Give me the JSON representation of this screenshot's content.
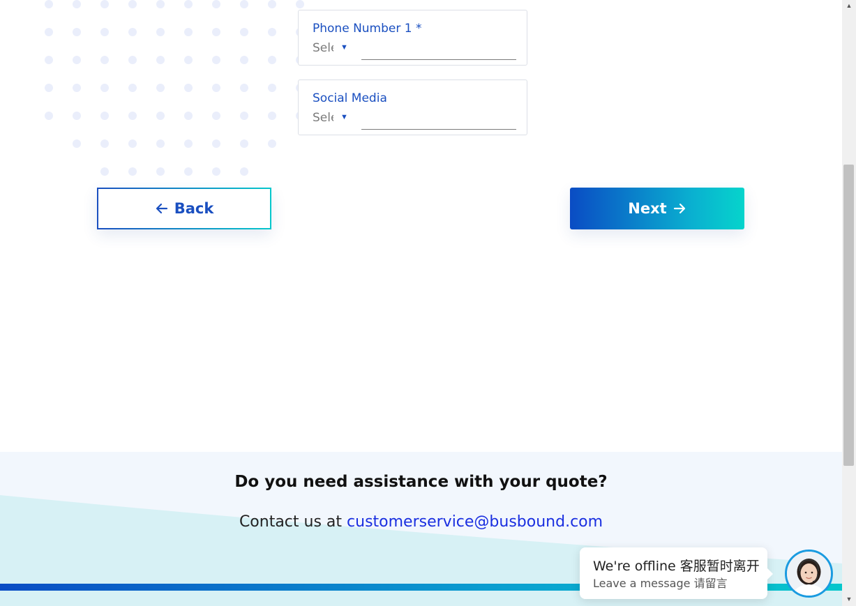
{
  "form": {
    "phone": {
      "label": "Phone Number 1 *",
      "select_text": "Select",
      "caret_icon": "caret-down-icon"
    },
    "social": {
      "label": "Social Media",
      "select_text": "Select",
      "caret_icon": "caret-down-icon"
    }
  },
  "navigation": {
    "back_label": "Back",
    "back_icon": "arrow-left-icon",
    "next_label": "Next",
    "next_icon": "arrow-right-icon"
  },
  "footer": {
    "title": "Do you need assistance with your quote?",
    "contact_prefix": "Contact us at",
    "contact_email": "customerservice@busbound.com"
  },
  "chat": {
    "status": "We're offline 客服暂时离开",
    "subtext": "Leave a message 请留言",
    "avatar_icon": "support-agent-avatar"
  },
  "colors": {
    "primary": "#1a4fc0",
    "accent": "#06c7cc",
    "link": "#1a2fe0",
    "footer_bg": "#f2f7fd"
  }
}
